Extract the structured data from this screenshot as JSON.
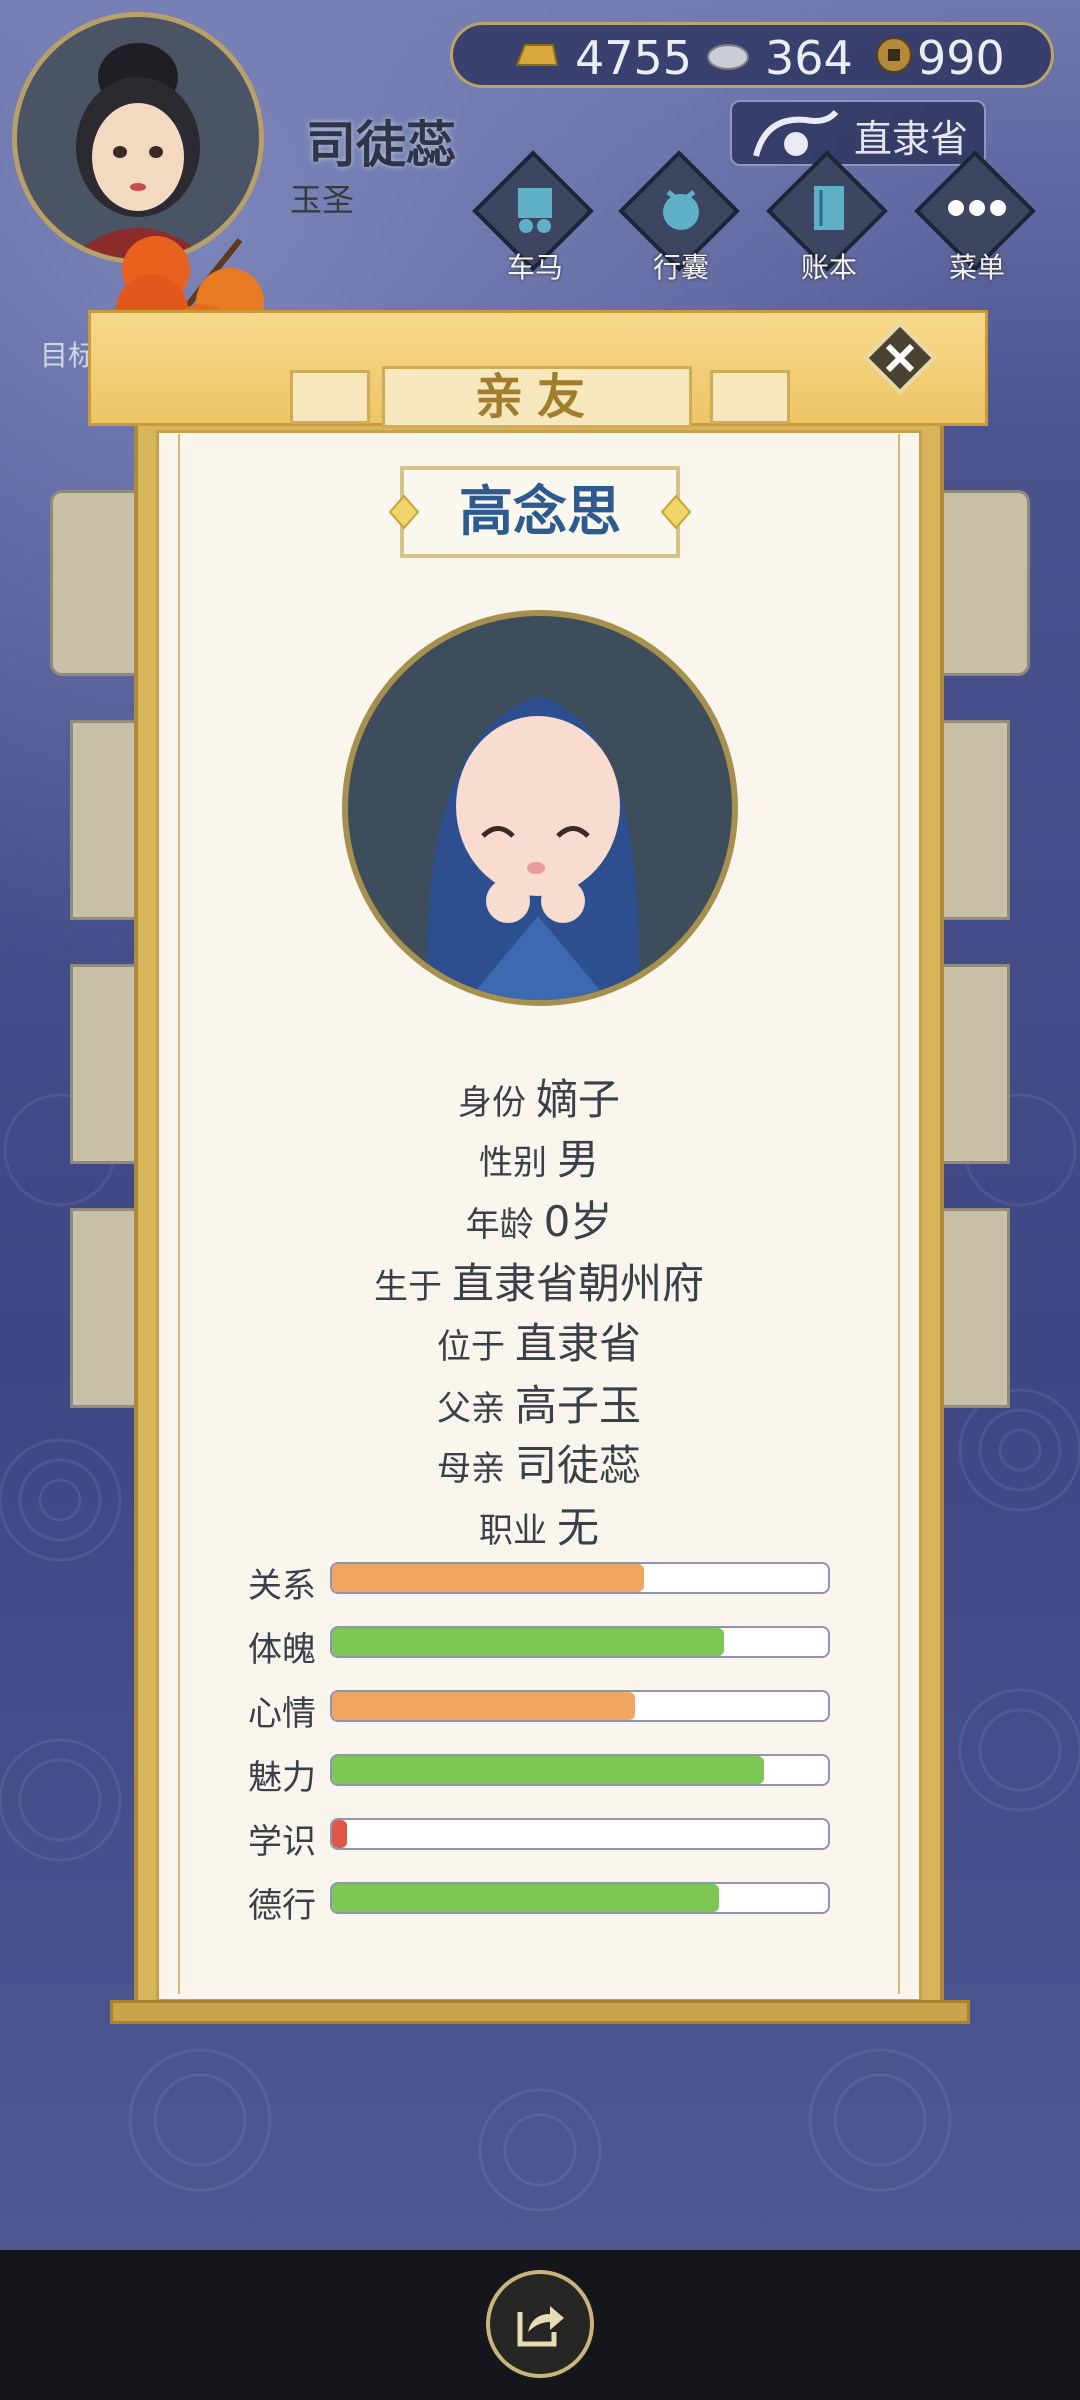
{
  "player": {
    "name": "司徒蕊",
    "title": "玉圣"
  },
  "currency": {
    "gold": "4755",
    "silver": "364",
    "coin": "990"
  },
  "location": "直隶省",
  "nav": [
    {
      "label": "车马",
      "icon": "carriage-icon"
    },
    {
      "label": "行囊",
      "icon": "bundle-icon"
    },
    {
      "label": "账本",
      "icon": "ledger-icon"
    },
    {
      "label": "菜单",
      "icon": "more-icon"
    }
  ],
  "target_label": "目标",
  "modal": {
    "title": "亲友",
    "person_name": "高念思",
    "info": [
      {
        "key": "身份",
        "value": "嫡子"
      },
      {
        "key": "性别",
        "value": "男"
      },
      {
        "key": "年龄",
        "value": "0岁"
      },
      {
        "key": "生于",
        "value": "直隶省朝州府"
      },
      {
        "key": "位于",
        "value": "直隶省"
      },
      {
        "key": "父亲",
        "value": "高子玉"
      },
      {
        "key": "母亲",
        "value": "司徒蕊"
      },
      {
        "key": "职业",
        "value": "无"
      }
    ],
    "stats": [
      {
        "label": "关系",
        "value": 0.63,
        "color": "#f0a560"
      },
      {
        "label": "体魄",
        "value": 0.79,
        "color": "#7cc653"
      },
      {
        "label": "心情",
        "value": 0.61,
        "color": "#f0a560"
      },
      {
        "label": "魅力",
        "value": 0.87,
        "color": "#7cc653"
      },
      {
        "label": "学识",
        "value": 0.03,
        "color": "#e05546"
      },
      {
        "label": "德行",
        "value": 0.78,
        "color": "#7cc653"
      }
    ]
  }
}
